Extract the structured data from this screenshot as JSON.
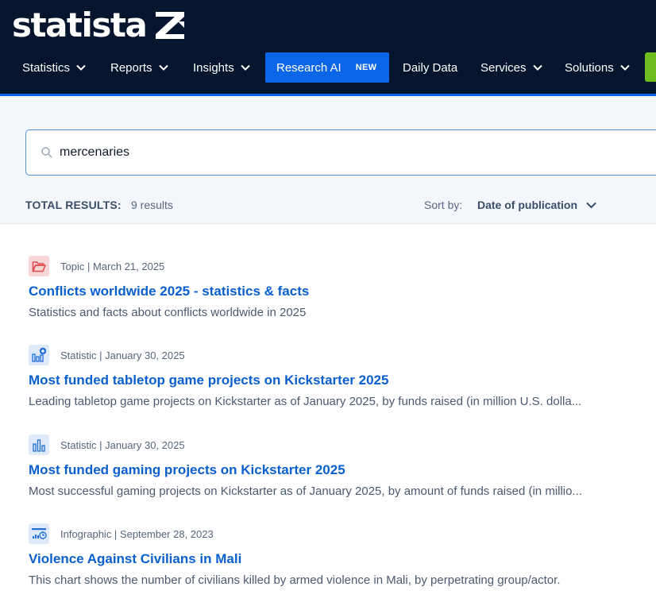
{
  "brand": {
    "name": "statista"
  },
  "nav": {
    "items": [
      {
        "label": "Statistics"
      },
      {
        "label": "Reports"
      },
      {
        "label": "Insights"
      },
      {
        "label": "Research AI",
        "badge": "NEW"
      },
      {
        "label": "Daily Data"
      },
      {
        "label": "Services"
      },
      {
        "label": "Solutions"
      }
    ]
  },
  "search": {
    "value": "mercenaries"
  },
  "results_bar": {
    "total_label": "TOTAL RESULTS:",
    "total_count": "9 results",
    "sort_label": "Sort by:",
    "sort_value": "Date of publication"
  },
  "results": [
    {
      "icon": "folder-icon",
      "meta": "Topic | March 21, 2025",
      "title": "Conflicts worldwide 2025 - statistics & facts",
      "description": "Statistics and facts about conflicts worldwide in 2025"
    },
    {
      "icon": "bar-chart-plus-icon",
      "meta": "Statistic | January 30, 2025",
      "title": "Most funded tabletop game projects on Kickstarter 2025",
      "description": "Leading tabletop game projects on Kickstarter as of January 2025, by funds raised (in million U.S. dolla..."
    },
    {
      "icon": "bar-chart-icon",
      "meta": "Statistic | January 30, 2025",
      "title": "Most funded gaming projects on Kickstarter 2025",
      "description": "Most successful gaming projects on Kickstarter as of January 2025, by amount of funds raised (in millio..."
    },
    {
      "icon": "infographic-icon",
      "meta": "Infographic | September 28, 2023",
      "title": "Violence Against Civilians in Mali",
      "description": "This chart shows the number of civilians killed by armed violence in Mali, by perpetrating group/actor."
    }
  ],
  "colors": {
    "header_bg": "#04152d",
    "accent_blue": "#0a66e6",
    "link_blue": "#0a5fcf",
    "cta_green": "#6cbe1f",
    "topic_icon_bg": "#f9d6d6",
    "statistic_icon_bg": "#dfeaf9"
  }
}
